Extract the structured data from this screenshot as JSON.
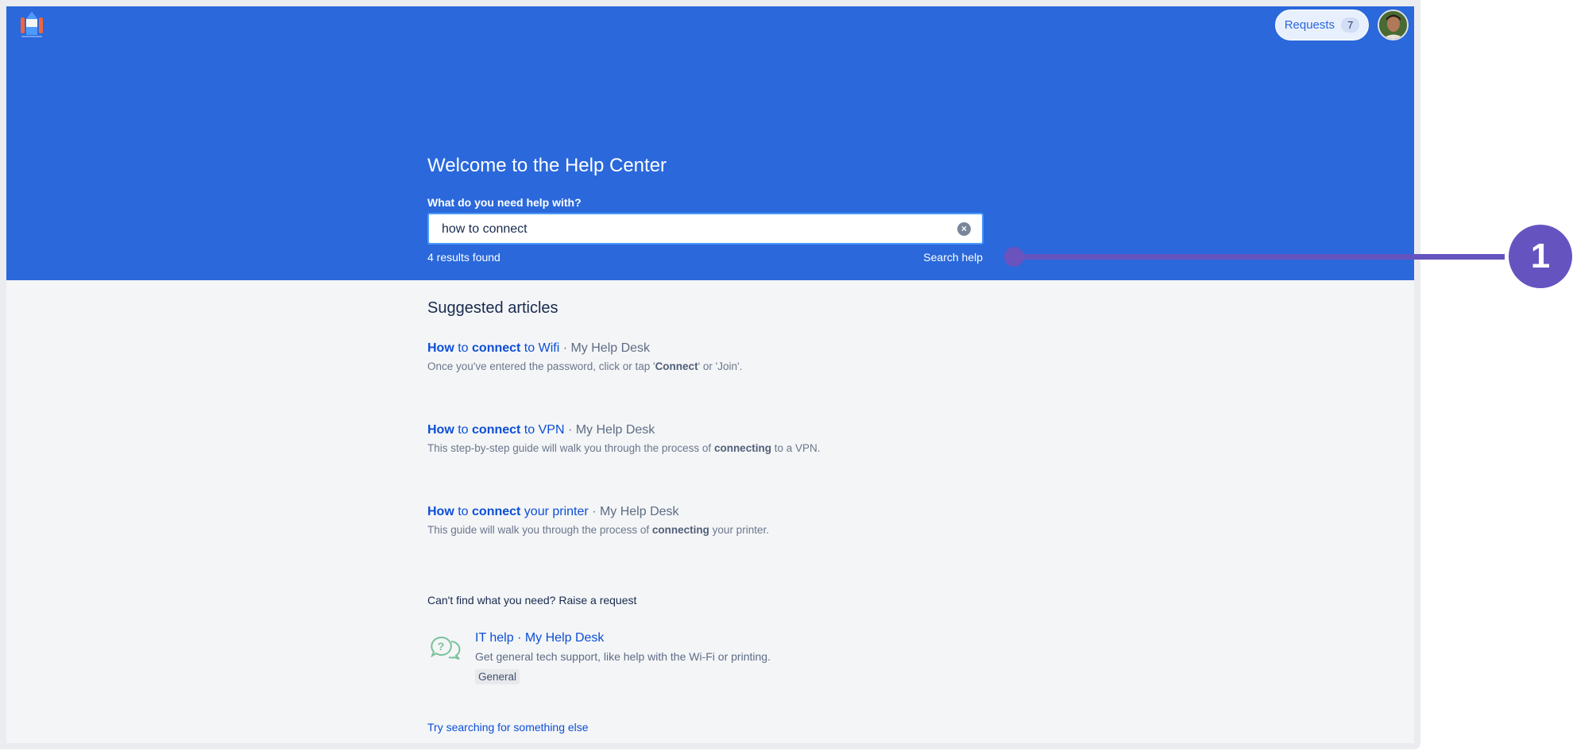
{
  "header": {
    "logo_icon": "rocket-logo-icon",
    "requests_label": "Requests",
    "requests_count": "7",
    "avatar_icon": "user-avatar"
  },
  "hero": {
    "title": "Welcome to the Help Center",
    "search_label": "What do you need help with?",
    "search_value": "how to connect",
    "clear_icon": "clear-circle-icon",
    "results_text": "4 results found",
    "search_help_label": "Search help"
  },
  "suggested": {
    "heading": "Suggested articles",
    "articles": [
      {
        "title": [
          {
            "text": "How",
            "bold": true
          },
          {
            "text": " to ",
            "bold": false
          },
          {
            "text": "connect",
            "bold": true
          },
          {
            "text": " to Wifi",
            "bold": false
          }
        ],
        "source": " · My Help Desk",
        "desc": [
          {
            "text": "Once you've entered the password, click or tap '",
            "bold": false
          },
          {
            "text": "Connect",
            "bold": true
          },
          {
            "text": "' or 'Join'.",
            "bold": false
          }
        ]
      },
      {
        "title": [
          {
            "text": "How",
            "bold": true
          },
          {
            "text": " to ",
            "bold": false
          },
          {
            "text": "connect",
            "bold": true
          },
          {
            "text": " to VPN",
            "bold": false
          }
        ],
        "source": " · My Help Desk",
        "desc": [
          {
            "text": "This step-by-step guide will walk you through the process of ",
            "bold": false
          },
          {
            "text": "connecting",
            "bold": true
          },
          {
            "text": " to a VPN.",
            "bold": false
          }
        ]
      },
      {
        "title": [
          {
            "text": "How",
            "bold": true
          },
          {
            "text": " to ",
            "bold": false
          },
          {
            "text": "connect",
            "bold": true
          },
          {
            "text": " your printer",
            "bold": false
          }
        ],
        "source": " · My Help Desk",
        "desc": [
          {
            "text": "This guide will walk you through the process of ",
            "bold": false
          },
          {
            "text": "connecting",
            "bold": true
          },
          {
            "text": " your printer.",
            "bold": false
          }
        ]
      }
    ]
  },
  "request": {
    "heading": "Can't find what you need? Raise a request",
    "icon": "question-chat-bubbles-icon",
    "title": "IT help · My Help Desk",
    "desc": "Get general tech support, like help with the Wi-Fi or printing.",
    "tag": "General"
  },
  "try_link": "Try searching for something else",
  "callout": {
    "number": "1"
  },
  "colors": {
    "banner": "#2a68db",
    "link": "#0c4fd6",
    "callout": "#6554c0",
    "background": "#f4f5f7"
  }
}
